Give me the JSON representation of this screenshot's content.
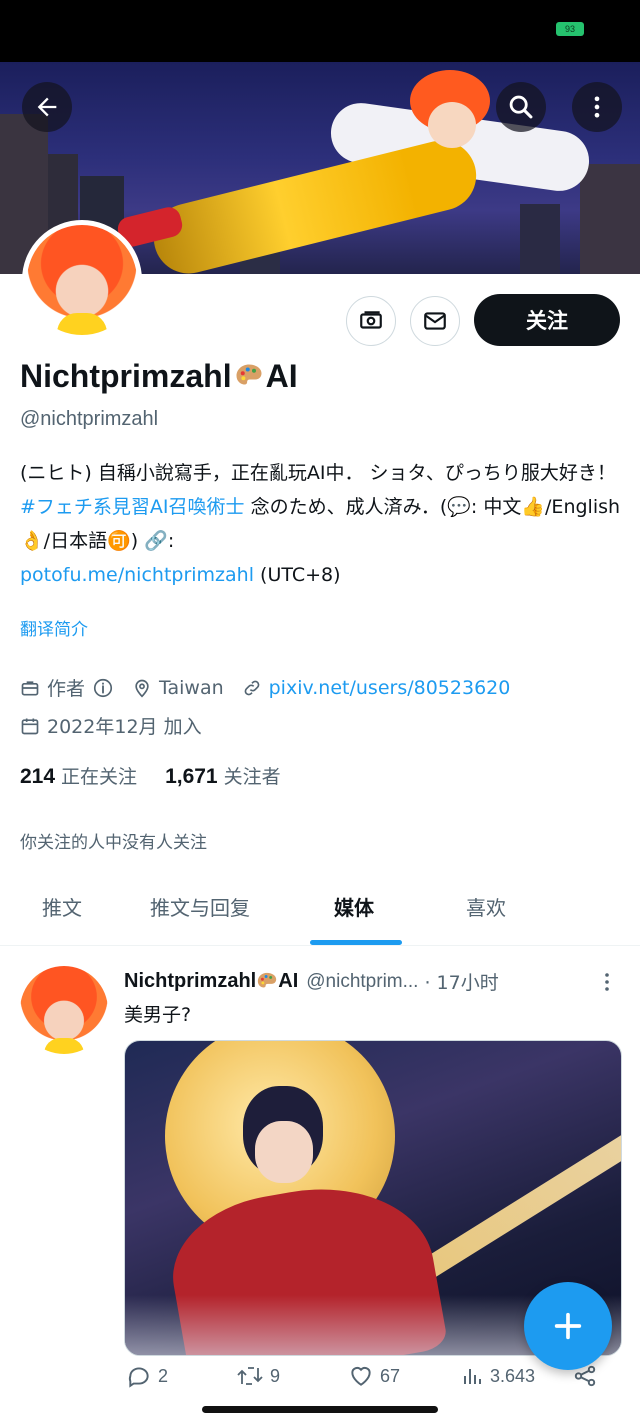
{
  "status_bar": {
    "battery": "93"
  },
  "profile": {
    "display_name": "Nichtprimzahl",
    "display_name_suffix": "AI",
    "handle": "@nichtprimzahl",
    "follow_label": "关注",
    "bio": {
      "part1": "(ニヒト) 自稱小說寫手，正在亂玩AI中． ショタ、ぴっちり服大好き！",
      "hashtag": "#フェチ系見習AI召喚術士",
      "part2": "念のため、成人済み．(",
      "part3": ": 中文",
      "part4": "/English",
      "part5": "/日本語",
      "part6": ")",
      "part7": ":",
      "link": "potofu.me/nichtprimzahl",
      "part8": "(UTC+8)"
    },
    "translate_label": "翻译简介",
    "category": "作者",
    "location": "Taiwan",
    "website": "pixiv.net/users/80523620",
    "joined": "2022年12月 加入",
    "following_count": "214",
    "following_label": "正在关注",
    "followers_count": "1,671",
    "followers_label": "关注者",
    "followed_by_note": "你关注的人中没有人关注"
  },
  "tabs": [
    {
      "label": "推文",
      "active": false
    },
    {
      "label": "推文与回复",
      "active": false
    },
    {
      "label": "媒体",
      "active": true
    },
    {
      "label": "喜欢",
      "active": false
    }
  ],
  "tweet": {
    "author": "Nichtprimzahl",
    "author_suffix": "AI",
    "handle": "@nichtprim...",
    "time": "· 17小时",
    "text": "美男子?",
    "replies": "2",
    "retweets": "9",
    "likes": "67",
    "views": "3.643"
  },
  "colors": {
    "accent": "#1d9bf0",
    "text": "#0f1419",
    "muted": "#536471",
    "follow_button": "#0f1419"
  },
  "icons": [
    "back-arrow-icon",
    "search-icon",
    "more-vertical-icon",
    "tip-icon",
    "mail-icon",
    "palette-emoji-icon",
    "briefcase-icon",
    "info-icon",
    "location-pin-icon",
    "link-icon",
    "calendar-icon",
    "reply-icon",
    "retweet-icon",
    "like-icon",
    "views-icon",
    "share-icon",
    "compose-plus-icon"
  ]
}
